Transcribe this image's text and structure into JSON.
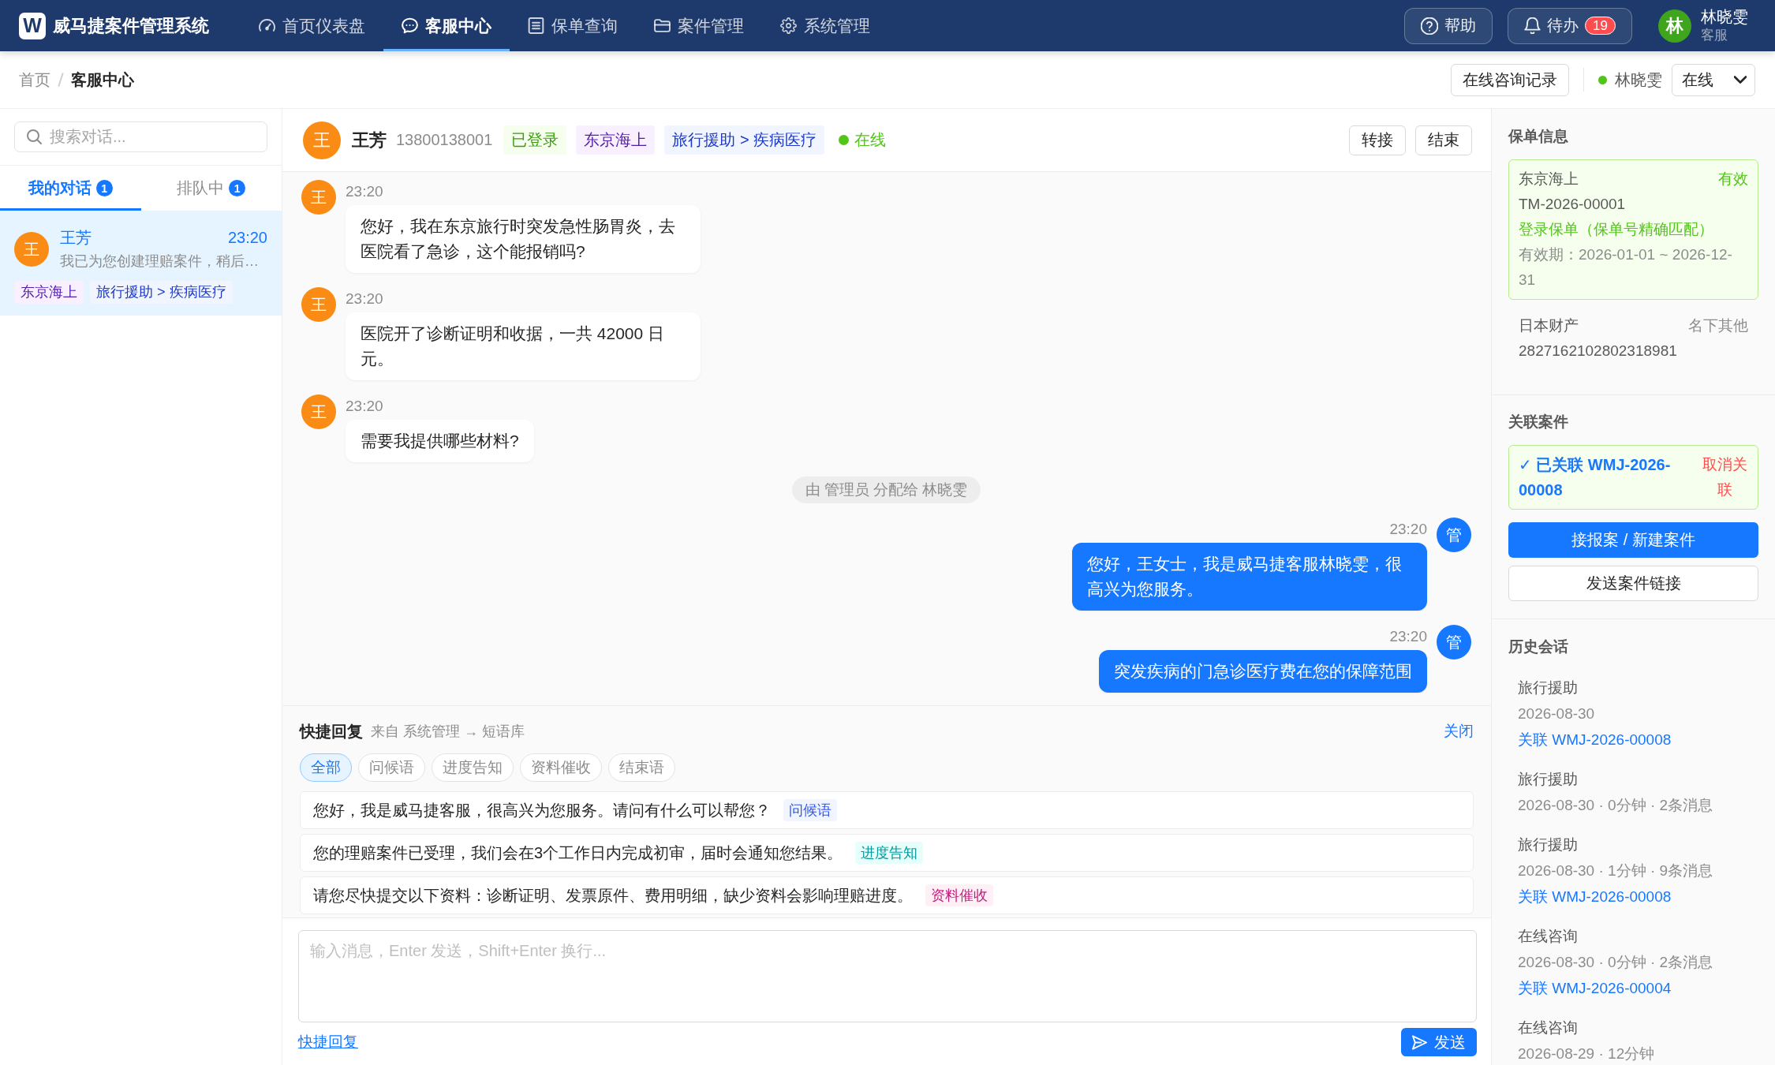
{
  "app": {
    "logo": "W",
    "title": "威马捷案件管理系统"
  },
  "nav": [
    {
      "label": "首页仪表盘",
      "selected": false
    },
    {
      "label": "客服中心",
      "selected": true
    },
    {
      "label": "保单查询",
      "selected": false
    },
    {
      "label": "案件管理",
      "selected": false
    },
    {
      "label": "系统管理",
      "selected": false
    }
  ],
  "header_actions": {
    "help": "帮助",
    "todo": {
      "label": "待办",
      "count": "19"
    }
  },
  "user": {
    "avatar": "林",
    "name": "林晓雯",
    "role": "客服"
  },
  "breadcrumb": [
    "首页",
    "客服中心"
  ],
  "toolbar": {
    "history_button": "在线咨询记录",
    "agent": {
      "name": "林晓雯",
      "online": true
    },
    "status_select": "在线"
  },
  "sidebar": {
    "search": {
      "placeholder": "搜索对话..."
    },
    "tabs": [
      {
        "label": "我的对话",
        "count": "1",
        "selected": true
      },
      {
        "label": "排队中",
        "count": "1",
        "selected": false
      }
    ],
    "conversations": [
      {
        "avatar": "王",
        "name": "王芳",
        "time": "23:20",
        "preview": "我已为您创建理赔案件，稍后…",
        "tags": [
          {
            "label": "东京海上",
            "kind": "insurer"
          },
          {
            "label": "旅行援助 > 疾病医疗",
            "kind": "category"
          }
        ],
        "selected": true
      }
    ]
  },
  "chat": {
    "contact": {
      "avatar": "王",
      "name": "王芳",
      "phone": "13800138001",
      "tags": [
        {
          "label": "已登录",
          "kind": "login"
        },
        {
          "label": "东京海上",
          "kind": "insurer"
        },
        {
          "label": "旅行援助 > 疾病医疗",
          "kind": "category"
        }
      ],
      "status": "在线",
      "online": true
    },
    "actions": [
      "转接",
      "结束"
    ],
    "messages": [
      {
        "kind": "customer",
        "avatar": "王",
        "time": "23:20",
        "text": "您好，我在东京旅行时突发急性肠胃炎，去医院看了急诊，这个能报销吗?"
      },
      {
        "kind": "customer",
        "avatar": "王",
        "time": "23:20",
        "text": "医院开了诊断证明和收据，一共 42000 日元。"
      },
      {
        "kind": "customer",
        "avatar": "王",
        "time": "23:20",
        "text": "需要我提供哪些材料?"
      },
      {
        "kind": "system",
        "text": "由 管理员 分配给 林晓雯"
      },
      {
        "kind": "agent",
        "avatar": "管",
        "time": "23:20",
        "text": "您好，王女士，我是威马捷客服林晓雯，很高兴为您服务。"
      },
      {
        "kind": "agent",
        "avatar": "管",
        "time": "23:20",
        "text": "突发疾病的门急诊医疗费在您的保障范围"
      }
    ]
  },
  "quick_replies": {
    "title": "快捷回复",
    "source": "来自 系统管理 → 短语库",
    "close": "关闭",
    "filters": [
      {
        "label": "全部",
        "selected": true
      },
      {
        "label": "问候语",
        "selected": false
      },
      {
        "label": "进度告知",
        "selected": false
      },
      {
        "label": "资料催收",
        "selected": false
      },
      {
        "label": "结束语",
        "selected": false
      }
    ],
    "items": [
      {
        "text": "您好，我是威马捷客服，很高兴为您服务。请问有什么可以帮您？",
        "tag": "问候语",
        "kind": "greeting"
      },
      {
        "text": "您的理赔案件已受理，我们会在3个工作日内完成初审，届时会通知您结果。",
        "tag": "进度告知",
        "kind": "progress"
      },
      {
        "text": "请您尽快提交以下资料：诊断证明、发票原件、费用明细，缺少资料会影响理赔进度。",
        "tag": "资料催收",
        "kind": "documents"
      }
    ]
  },
  "composer": {
    "placeholder": "输入消息，Enter 发送，Shift+Enter 换行...",
    "quick_reply_link": "快捷回复",
    "send": "发送"
  },
  "right_panel": {
    "policy": {
      "title": "保单信息",
      "policies": [
        {
          "insurer": "东京海上",
          "status": "有效",
          "number": "TM-2026-00001",
          "match": "登录保单（保单号精确匹配）",
          "validity": "有效期：2026-01-01 ~ 2026-12-31",
          "selected": true
        },
        {
          "insurer": "日本财产",
          "status": "名下其他",
          "number": "2827162102802318981",
          "selected": false
        }
      ]
    },
    "linked_case": {
      "title": "关联案件",
      "linked": "✓ 已关联 WMJ-2026-00008",
      "unlink": "取消关联",
      "actions": [
        {
          "label": "接报案 / 新建案件",
          "kind": "primary"
        },
        {
          "label": "发送案件链接",
          "kind": "default"
        }
      ]
    },
    "history": {
      "title": "历史会话",
      "sessions": [
        {
          "type": "旅行援助",
          "meta": "2026-08-30",
          "link": "关联 WMJ-2026-00008"
        },
        {
          "type": "旅行援助",
          "meta": "2026-08-30 · 0分钟 · 2条消息"
        },
        {
          "type": "旅行援助",
          "meta": "2026-08-30 · 1分钟 · 9条消息",
          "link": "关联 WMJ-2026-00008"
        },
        {
          "type": "在线咨询",
          "meta": "2026-08-30 · 0分钟 · 2条消息",
          "link": "关联 WMJ-2026-00004"
        },
        {
          "type": "在线咨询",
          "meta": "2026-08-29 · 12分钟"
        }
      ]
    }
  }
}
